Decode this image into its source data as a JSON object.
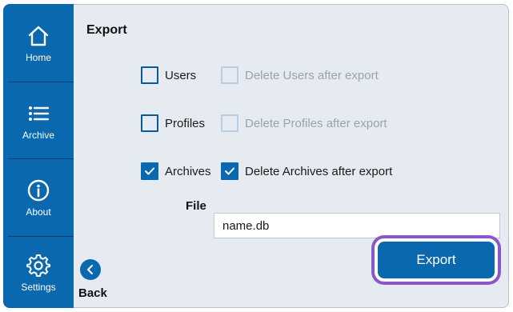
{
  "sidebar": {
    "items": [
      {
        "label": "Home",
        "icon": "home-icon"
      },
      {
        "label": "Archive",
        "icon": "list-icon"
      },
      {
        "label": "About",
        "icon": "info-icon"
      },
      {
        "label": "Settings",
        "icon": "gear-icon"
      }
    ]
  },
  "main": {
    "title": "Export",
    "options": [
      {
        "label": "Users",
        "checked": false,
        "delete_label": "Delete Users after export",
        "delete_checked": false,
        "delete_enabled": false
      },
      {
        "label": "Profiles",
        "checked": false,
        "delete_label": "Delete Profiles after export",
        "delete_checked": false,
        "delete_enabled": false
      },
      {
        "label": "Archives",
        "checked": true,
        "delete_label": "Delete Archives after export",
        "delete_checked": true,
        "delete_enabled": true
      }
    ],
    "file": {
      "label": "File",
      "value": "name.db"
    },
    "back_label": "Back",
    "export_label": "Export"
  },
  "colors": {
    "accent": "#0a68ae",
    "highlight": "#8a59c9",
    "background": "#e6ebf2"
  }
}
